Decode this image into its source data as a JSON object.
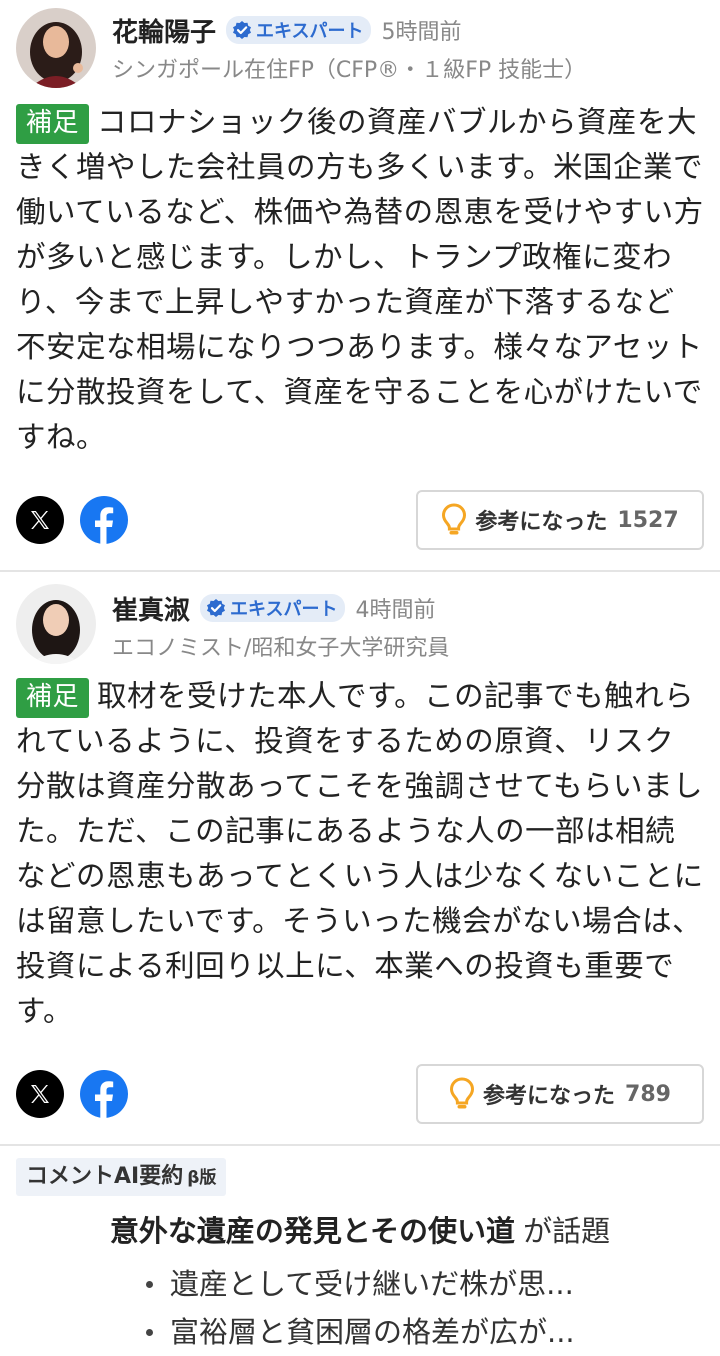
{
  "comments": [
    {
      "author": "花輪陽子",
      "badge": "エキスパート",
      "time": "5時間前",
      "profile": "シンガポール在住FP（CFP®・１級FP 技能士）",
      "tag": "補足",
      "body": "コロナショック後の資産バブルから資産を大きく増やした会社員の方も多くいます。米国企業で働いているなど、株価や為替の恩恵を受けやすい方が多いと感じます。しかし、トランプ政権に変わり、今まで上昇しやすかった資産が下落するなど不安定な相場になりつつあります。様々なアセットに分散投資をして、資産を守ることを心がけたいですね。",
      "helpful_label": "参考になった",
      "helpful_count": "1527"
    },
    {
      "author": "崔真淑",
      "badge": "エキスパート",
      "time": "4時間前",
      "profile": "エコノミスト/昭和女子大学研究員",
      "tag": "補足",
      "body": "取材を受けた本人です。この記事でも触れられているように、投資をするための原資、リスク分散は資産分散あってこそを強調させてもらいました。ただ、この記事にあるような人の一部は相続などの恩恵もあってとくいう人は少なくないことには留意したいです。そういった機会がない場合は、投資による利回り以上に、本業への投資も重要です。",
      "helpful_label": "参考になった",
      "helpful_count": "789"
    }
  ],
  "summary": {
    "label": "コメントAI要約",
    "beta": "β版",
    "topic": "意外な遺産の発見とその使い道",
    "suffix": "が話題",
    "bullets": [
      "遺産として受け継いだ株が思...",
      "富裕層と貧困層の格差が広が..."
    ]
  },
  "icons": {
    "verified": "verified-check-icon",
    "x": "x-logo-icon",
    "facebook": "facebook-logo-icon",
    "helpful": "lightbulb-icon"
  },
  "colors": {
    "tag_green": "#2f9e44",
    "badge_blue": "#2d6bcf",
    "facebook_blue": "#1877f2",
    "bulb_orange": "#f5a623"
  }
}
